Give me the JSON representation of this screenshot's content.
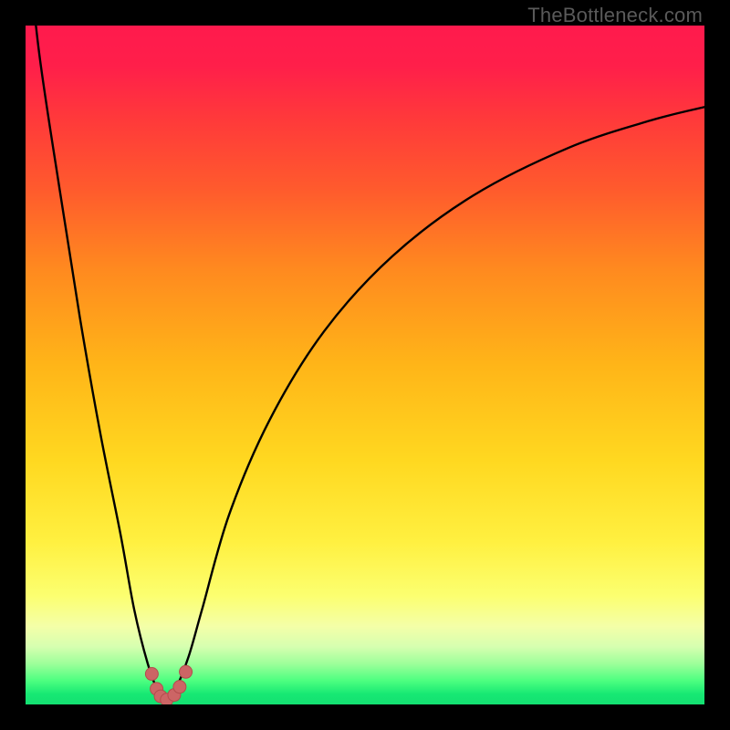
{
  "watermark": "TheBottleneck.com",
  "colors": {
    "frame": "#000000",
    "curve": "#000000",
    "dot_fill": "#cc6565",
    "dot_stroke": "#b34d4d",
    "gradient_stops": [
      {
        "offset": 0.0,
        "color": "#ff1a4d"
      },
      {
        "offset": 0.06,
        "color": "#ff1f4a"
      },
      {
        "offset": 0.14,
        "color": "#ff3a3a"
      },
      {
        "offset": 0.24,
        "color": "#ff5a2d"
      },
      {
        "offset": 0.36,
        "color": "#ff8a1f"
      },
      {
        "offset": 0.5,
        "color": "#ffb518"
      },
      {
        "offset": 0.64,
        "color": "#ffd820"
      },
      {
        "offset": 0.76,
        "color": "#fff040"
      },
      {
        "offset": 0.84,
        "color": "#fcff70"
      },
      {
        "offset": 0.885,
        "color": "#f4ffa8"
      },
      {
        "offset": 0.915,
        "color": "#d6ffb0"
      },
      {
        "offset": 0.94,
        "color": "#9dff9a"
      },
      {
        "offset": 0.965,
        "color": "#4dff80"
      },
      {
        "offset": 0.985,
        "color": "#16e873"
      },
      {
        "offset": 1.0,
        "color": "#14e072"
      }
    ]
  },
  "chart_data": {
    "type": "line",
    "title": "",
    "xlabel": "",
    "ylabel": "",
    "xlim": [
      0,
      100
    ],
    "ylim": [
      0,
      100
    ],
    "grid": false,
    "series": [
      {
        "name": "bottleneck-curve",
        "x": [
          0,
          2,
          5,
          8,
          11,
          14,
          16,
          18,
          19.5,
          20.8,
          22,
          24,
          26,
          30,
          36,
          44,
          54,
          66,
          80,
          92,
          100
        ],
        "y": [
          115,
          96,
          76,
          57,
          40,
          25,
          14,
          6,
          2,
          0.5,
          2,
          7,
          14,
          28,
          42,
          55,
          66,
          75,
          82,
          86,
          88
        ]
      }
    ],
    "points": [
      {
        "x": 18.6,
        "y": 4.5
      },
      {
        "x": 19.3,
        "y": 2.3
      },
      {
        "x": 19.9,
        "y": 1.2
      },
      {
        "x": 20.8,
        "y": 0.7
      },
      {
        "x": 21.9,
        "y": 1.4
      },
      {
        "x": 22.7,
        "y": 2.6
      },
      {
        "x": 23.6,
        "y": 4.8
      }
    ],
    "annotations": []
  }
}
